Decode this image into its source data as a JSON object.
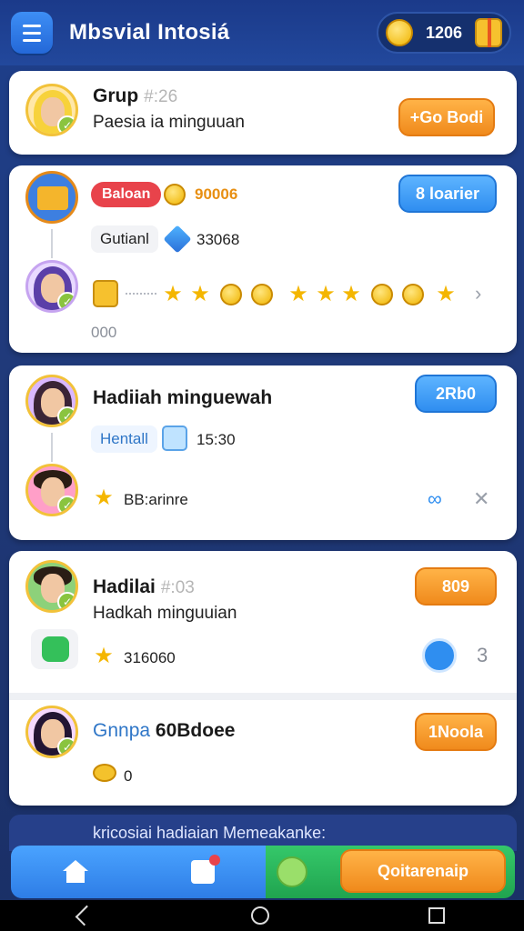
{
  "header": {
    "title": "Mbsvial Intosiá",
    "coins": "1206"
  },
  "cards": [
    {
      "title": "Grup",
      "number": "#:26",
      "subtitle": "Paesia ia minguuan",
      "button": "+Go Bodi"
    },
    {
      "badge": "Baloan",
      "badge_value": "90006",
      "tag": "Gutianl",
      "tag_value": "33068",
      "button": "8 loarier",
      "row_label": "000"
    },
    {
      "title": "Hadiiah minguewah",
      "tag": "Hentall",
      "time": "15:30",
      "row_label": "BB:arinre",
      "button": "2Rb0"
    },
    {
      "title": "Hadilai",
      "number": "#:03",
      "subtitle": "Hadkah minguuian",
      "row_value": "316060",
      "count": "3",
      "button": "809"
    },
    {
      "title_colored": "Gnnpa",
      "title_value": "60Bdoee",
      "row_value": "0",
      "button": "1Noola"
    }
  ],
  "notice": "kricosiai hadiaian Memeakanke:",
  "bottom": {
    "play_label": "Qoitarenaip"
  },
  "icons": {
    "menu": "menu-icon",
    "coin": "coin-icon",
    "gift": "gift-icon",
    "home": "home-icon",
    "puzzle": "puzzle-icon"
  },
  "colors": {
    "orange": "#f08a1c",
    "blue": "#2f8ef0",
    "red": "#e8434b",
    "green": "#20a44f"
  }
}
